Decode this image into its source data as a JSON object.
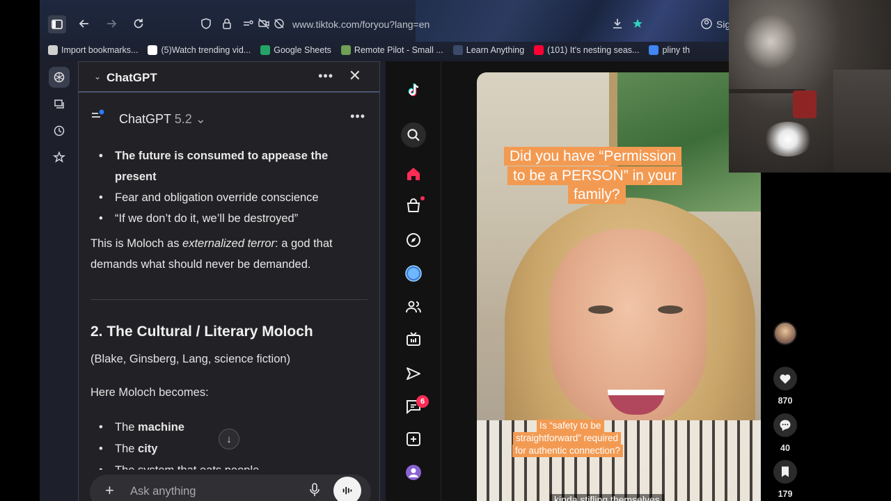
{
  "browser": {
    "url": "www.tiktok.com/foryou?lang=en",
    "profile_text": "Sig",
    "bookmarks": [
      {
        "label": "Import bookmarks...",
        "icon": "import-icon",
        "color": "#d0d0d0"
      },
      {
        "label": "(5)Watch trending vid...",
        "icon": "tiktok-icon",
        "color": "#ffffff"
      },
      {
        "label": "Google Sheets",
        "icon": "sheets-icon",
        "color": "#23a566"
      },
      {
        "label": "Remote Pilot - Small ...",
        "icon": "remote-pilot-icon",
        "color": "#6fa055"
      },
      {
        "label": "Learn Anything",
        "icon": "learn-icon",
        "color": "#3c4a6a"
      },
      {
        "label": "(101) It's nesting seas...",
        "icon": "youtube-icon",
        "color": "#ff0033"
      },
      {
        "label": "pliny th",
        "icon": "google-icon",
        "color": "#4285f4"
      }
    ]
  },
  "chat": {
    "panel_title": "ChatGPT",
    "model_name": "ChatGPT",
    "model_version": "5.2",
    "bullets_top": [
      {
        "text": "The future is consumed to appease the present",
        "bold": true
      },
      {
        "text": "Fear and obligation override conscience",
        "bold": false
      },
      {
        "text": "“If we don’t do it, we’ll be destroyed”",
        "bold": false
      }
    ],
    "para_before": "This is Moloch as ",
    "para_italic": "externalized terror",
    "para_after": ": a god that demands what should never be demanded.",
    "heading": "2. The Cultural / Literary Moloch",
    "subheading": "(Blake, Ginsberg, Lang, science fiction)",
    "intro": "Here Moloch becomes:",
    "bullets_bottom": [
      {
        "prefix": "The ",
        "bold": "machine"
      },
      {
        "prefix": "The ",
        "bold": "city"
      },
      {
        "prefix": "The system that eats people",
        "bold": ""
      }
    ],
    "composer_placeholder": "Ask anything"
  },
  "tiktok": {
    "inbox_badge": "6",
    "caption_top": [
      "Did you have “Permission",
      "to be a PERSON” in your",
      "family?"
    ],
    "caption_mid": [
      "Is “safety to be",
      "straightforward” required",
      "for authentic connection?"
    ],
    "caption_bottom": "kinda stifling themselves",
    "likes": "870",
    "comments": "40",
    "saves": "179",
    "accent_color": "#fe2c55",
    "caption_color": "#f39a52"
  }
}
